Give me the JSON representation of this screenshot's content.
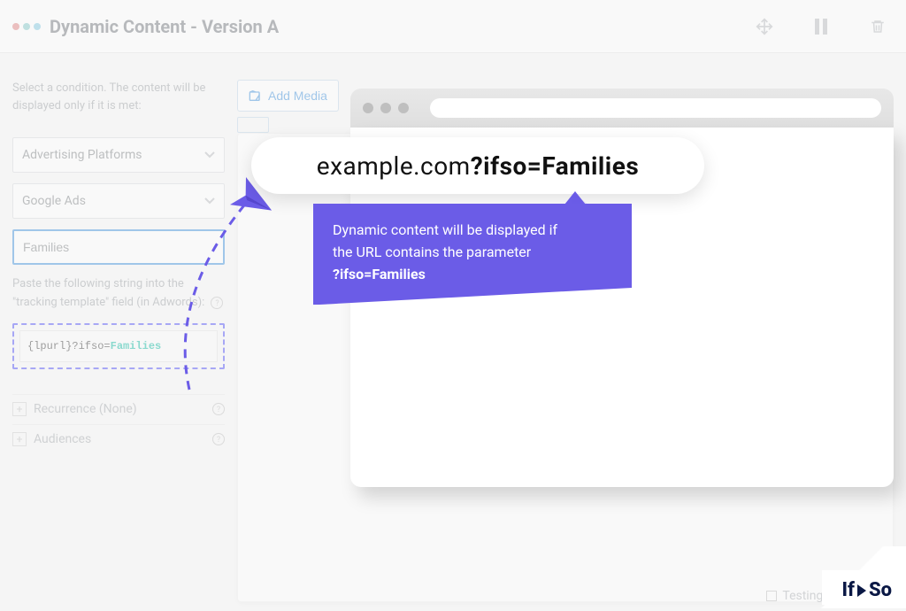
{
  "header": {
    "title": "Dynamic Content - Version A"
  },
  "sidebar": {
    "instruction": "Select a condition. The content will be displayed only if it is met:",
    "condition_type": "Advertising Platforms",
    "platform": "Google Ads",
    "input_value": "Families",
    "tracking_instruction_1": "Paste the following string into the \"tracking template\" field (in Adwords):",
    "tracking_prefix": "{lpurl}?ifso=",
    "tracking_value": "Families",
    "rows": {
      "recurrence": "Recurrence (None)",
      "audiences": "Audiences"
    }
  },
  "content": {
    "add_media_label": "Add Media"
  },
  "url_pill": {
    "base": "example.com",
    "query": "?ifso=Families"
  },
  "callout": {
    "line1": "Dynamic content will be displayed if",
    "line2": "the URL contains the parameter",
    "line3": "?ifso=Families"
  },
  "footer": {
    "testing_label": "Testing M"
  },
  "brand": {
    "part1": "If",
    "part2": "So"
  }
}
